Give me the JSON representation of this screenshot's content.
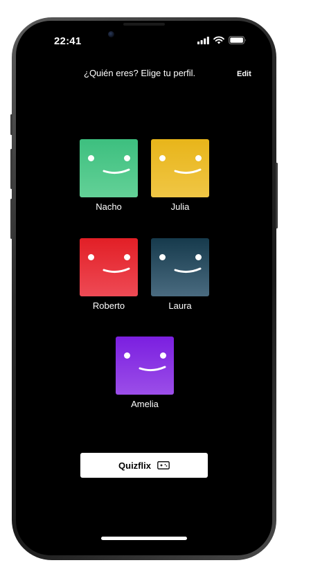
{
  "status_bar": {
    "time": "22:41"
  },
  "header": {
    "title": "¿Quién eres? Elige tu perfil.",
    "edit_label": "Edit"
  },
  "profiles": [
    {
      "name": "Nacho",
      "color_top": "#3dbf7f",
      "color_bottom": "#63d197"
    },
    {
      "name": "Julia",
      "color_top": "#e8b51a",
      "color_bottom": "#f0c645"
    },
    {
      "name": "Roberto",
      "color_top": "#e21f26",
      "color_bottom": "#ee4a55"
    },
    {
      "name": "Laura",
      "color_top": "#163a4c",
      "color_bottom": "#4a6b80"
    },
    {
      "name": "Amelia",
      "color_top": "#7b1fe0",
      "color_bottom": "#9b4ee8"
    }
  ],
  "quiz_button": {
    "label": "Quizflix",
    "icon": "gamepad-icon"
  }
}
